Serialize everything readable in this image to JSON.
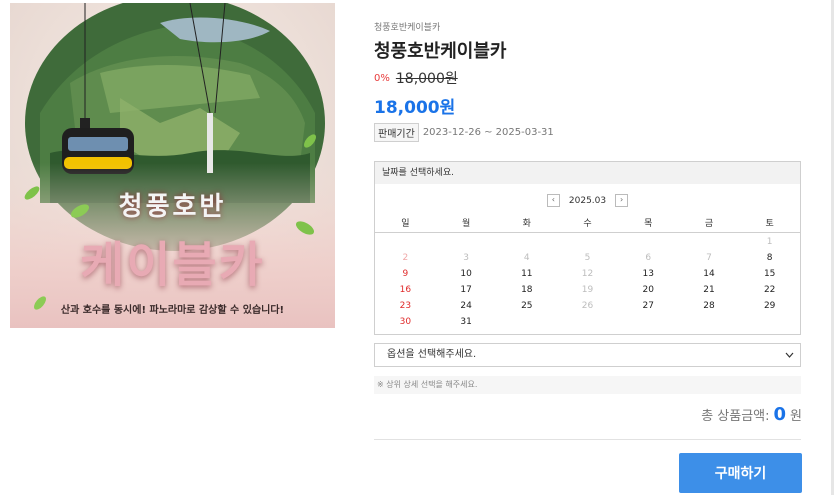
{
  "product": {
    "breadcrumb": "청풍호반케이블카",
    "name": "청풍호반케이블카",
    "discount": "0%",
    "original_price": "18,000원",
    "price": "18,000원",
    "sale_period_label": "판매기간",
    "sale_period": "2023-12-26 ~ 2025-03-31"
  },
  "hero": {
    "title_small": "청풍호반",
    "title_large": "케이블카",
    "caption": "산과 호수를 동시에! 파노라마로 감상할 수 있습니다!"
  },
  "calendar": {
    "header": "날짜를 선택하세요.",
    "month": "2025.03",
    "prev_icon": "‹",
    "next_icon": "›",
    "weekdays": [
      "일",
      "월",
      "화",
      "수",
      "목",
      "금",
      "토"
    ],
    "weeks": [
      [
        {
          "d": ""
        },
        {
          "d": ""
        },
        {
          "d": ""
        },
        {
          "d": ""
        },
        {
          "d": ""
        },
        {
          "d": ""
        },
        {
          "d": "1",
          "disabled": true
        }
      ],
      [
        {
          "d": "2",
          "disabled": true
        },
        {
          "d": "3",
          "disabled": true
        },
        {
          "d": "4",
          "disabled": true
        },
        {
          "d": "5",
          "disabled": true
        },
        {
          "d": "6",
          "disabled": true
        },
        {
          "d": "7",
          "disabled": true
        },
        {
          "d": "8"
        }
      ],
      [
        {
          "d": "9"
        },
        {
          "d": "10"
        },
        {
          "d": "11"
        },
        {
          "d": "12",
          "disabled": true
        },
        {
          "d": "13"
        },
        {
          "d": "14"
        },
        {
          "d": "15"
        }
      ],
      [
        {
          "d": "16"
        },
        {
          "d": "17"
        },
        {
          "d": "18"
        },
        {
          "d": "19",
          "disabled": true
        },
        {
          "d": "20"
        },
        {
          "d": "21"
        },
        {
          "d": "22"
        }
      ],
      [
        {
          "d": "23"
        },
        {
          "d": "24"
        },
        {
          "d": "25"
        },
        {
          "d": "26",
          "disabled": true
        },
        {
          "d": "27"
        },
        {
          "d": "28"
        },
        {
          "d": "29"
        }
      ],
      [
        {
          "d": "30"
        },
        {
          "d": "31"
        },
        {
          "d": ""
        },
        {
          "d": ""
        },
        {
          "d": ""
        },
        {
          "d": ""
        },
        {
          "d": ""
        }
      ]
    ]
  },
  "option": {
    "select_value": "옵션을 선택해주세요.",
    "chevron_icon": "chevron-down-icon",
    "hint": "※ 상위 상세 선택을 해주세요."
  },
  "total": {
    "label": "총 상품금액:",
    "value": "0",
    "unit": "원"
  },
  "buy_button": "구매하기",
  "colors": {
    "accent": "#1a73e8",
    "button": "#3d8fe8",
    "discount": "#e83b3b",
    "sunday": "#e02b2b"
  }
}
